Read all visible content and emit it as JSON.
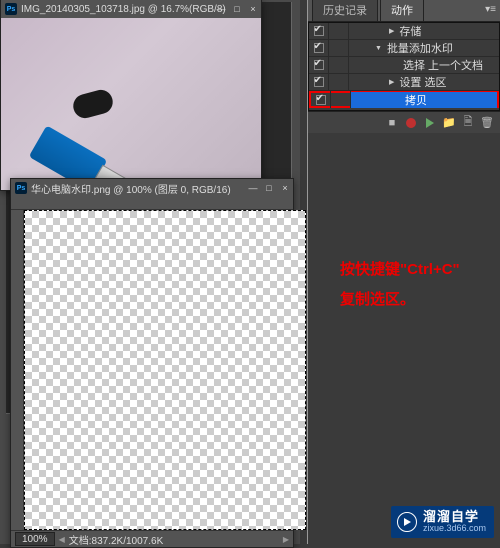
{
  "doc1": {
    "title": "IMG_20140305_103718.jpg @ 16.7%(RGB/8)"
  },
  "doc2": {
    "title": "华心电脑水印.png @ 100% (图层 0, RGB/16)",
    "zoom": "100%",
    "status": "文档:837.2K/1007.6K"
  },
  "panel": {
    "tabs": {
      "history": "历史记录",
      "actions": "动作"
    },
    "rows": {
      "save": "存储",
      "batch": "批量添加水印",
      "select_prev": "选择 上一个文档",
      "set_sel": "设置 选区",
      "copy": "拷贝"
    }
  },
  "annotation": {
    "line1": "按快捷键\"Ctrl+C\"",
    "line2": "复制选区。"
  },
  "watermark": {
    "line1": "溜溜自学",
    "line2": "zixue.3d66.com"
  }
}
